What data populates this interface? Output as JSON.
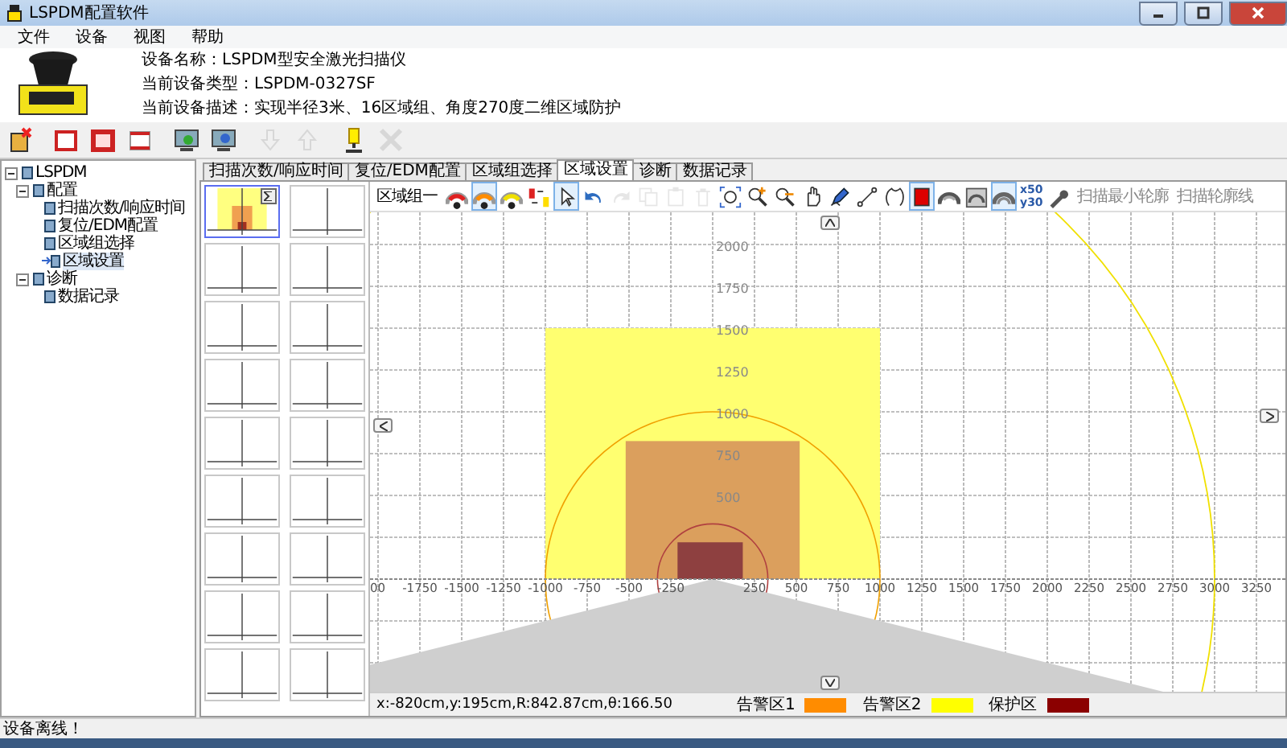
{
  "window": {
    "title": "LSPDM配置软件"
  },
  "menu": [
    "文件",
    "设备",
    "视图",
    "帮助"
  ],
  "device": {
    "name": "设备名称：LSPDM型安全激光扫描仪",
    "type": "当前设备类型：LSPDM-0327SF",
    "description": "当前设备描述：实现半径3米、16区域组、角度270度二维区域防护"
  },
  "toolbar": [
    {
      "kind": "new",
      "disabled": false
    },
    {
      "kind": "frame-thin",
      "disabled": false
    },
    {
      "kind": "frame-bold",
      "disabled": false
    },
    {
      "kind": "frame-flat",
      "disabled": false
    },
    {
      "kind": "net-down",
      "disabled": false
    },
    {
      "kind": "net-up",
      "disabled": false
    },
    {
      "kind": "download",
      "disabled": true
    },
    {
      "kind": "upload",
      "disabled": true
    },
    {
      "kind": "light",
      "disabled": false
    },
    {
      "kind": "disconnect",
      "disabled": true
    }
  ],
  "tree": [
    {
      "label": "LSPDM",
      "expanded": true,
      "selected": false,
      "children": [
        {
          "label": "配置",
          "expanded": true,
          "selected": false,
          "children": [
            {
              "label": "扫描次数/响应时间",
              "selected": false
            },
            {
              "label": "复位/EDM配置",
              "selected": false
            },
            {
              "label": "区域组选择",
              "selected": false
            },
            {
              "label": "区域设置",
              "selected": true
            }
          ]
        },
        {
          "label": "诊断",
          "expanded": true,
          "selected": false,
          "children": [
            {
              "label": "数据记录",
              "selected": false
            }
          ]
        }
      ]
    }
  ],
  "tabs": [
    {
      "label": "扫描次数/响应时间",
      "selected": false
    },
    {
      "label": "复位/EDM配置",
      "selected": false
    },
    {
      "label": "区域组选择",
      "selected": false
    },
    {
      "label": "区域设置",
      "selected": true
    },
    {
      "label": "诊断",
      "selected": false
    },
    {
      "label": "数据记录",
      "selected": false
    }
  ],
  "zone_thumbnails": [
    {
      "selected": true,
      "configured": true
    },
    {
      "selected": false,
      "configured": false
    },
    {
      "selected": false,
      "configured": false
    },
    {
      "selected": false,
      "configured": false
    },
    {
      "selected": false,
      "configured": false
    },
    {
      "selected": false,
      "configured": false
    },
    {
      "selected": false,
      "configured": false
    },
    {
      "selected": false,
      "configured": false
    },
    {
      "selected": false,
      "configured": false
    },
    {
      "selected": false,
      "configured": false
    },
    {
      "selected": false,
      "configured": false
    },
    {
      "selected": false,
      "configured": false
    },
    {
      "selected": false,
      "configured": false
    },
    {
      "selected": false,
      "configured": false
    },
    {
      "selected": false,
      "configured": false
    },
    {
      "selected": false,
      "configured": false
    },
    {
      "selected": false,
      "configured": false
    },
    {
      "selected": false,
      "configured": false
    }
  ],
  "zone_group": "区域组一",
  "tools": [
    {
      "kind": "zone-protect",
      "selected": false,
      "disabled": false
    },
    {
      "kind": "zone-warn1",
      "selected": true,
      "disabled": false
    },
    {
      "kind": "zone-warn2",
      "selected": false,
      "disabled": false
    },
    {
      "kind": "swap",
      "selected": false,
      "disabled": false
    },
    {
      "kind": "pointer",
      "selected": true,
      "disabled": false
    },
    {
      "kind": "undo",
      "selected": false,
      "disabled": false
    },
    {
      "kind": "redo",
      "selected": false,
      "disabled": true
    },
    {
      "kind": "copy",
      "selected": false,
      "disabled": true
    },
    {
      "kind": "paste",
      "selected": false,
      "disabled": true
    },
    {
      "kind": "delete",
      "selected": false,
      "disabled": true
    },
    {
      "kind": "fit",
      "selected": false,
      "disabled": false
    },
    {
      "kind": "zoom-in",
      "selected": false,
      "disabled": false
    },
    {
      "kind": "zoom-out",
      "selected": false,
      "disabled": false
    },
    {
      "kind": "hand",
      "selected": false,
      "disabled": false
    },
    {
      "kind": "pen",
      "selected": false,
      "disabled": false
    },
    {
      "kind": "line",
      "selected": false,
      "disabled": false
    },
    {
      "kind": "contour",
      "selected": false,
      "disabled": false
    },
    {
      "kind": "tile",
      "selected": true,
      "disabled": false
    },
    {
      "kind": "arc-a",
      "selected": false,
      "disabled": false
    },
    {
      "kind": "arc-b",
      "selected": false,
      "disabled": false
    },
    {
      "kind": "arc-c",
      "selected": true,
      "disabled": false
    }
  ],
  "grid_step": {
    "x": "x50",
    "y": "y30"
  },
  "text_tools": [
    "扫描最小轮廓",
    "扫描轮廓线"
  ],
  "plot": {
    "x_labels": [
      "00",
      "-1750",
      "-1500",
      "-1250",
      "-1000",
      "-750",
      "-500",
      "-250",
      "250",
      "500",
      "750",
      "1000",
      "1250",
      "1500",
      "1750",
      "2000",
      "2250",
      "2500",
      "2750",
      "3000",
      "3250"
    ],
    "y_labels": [
      "2000",
      "1750",
      "1500",
      "1250",
      "1000",
      "750",
      "500"
    ]
  },
  "coordinates": "x:-820cm,y:195cm,R:842.87cm,θ:166.50",
  "legend": [
    {
      "label": "告警区1",
      "color": "#ff8c00"
    },
    {
      "label": "告警区2",
      "color": "#ffff00"
    },
    {
      "label": "保护区",
      "color": "#8b0000"
    }
  ],
  "status": "设备离线！"
}
